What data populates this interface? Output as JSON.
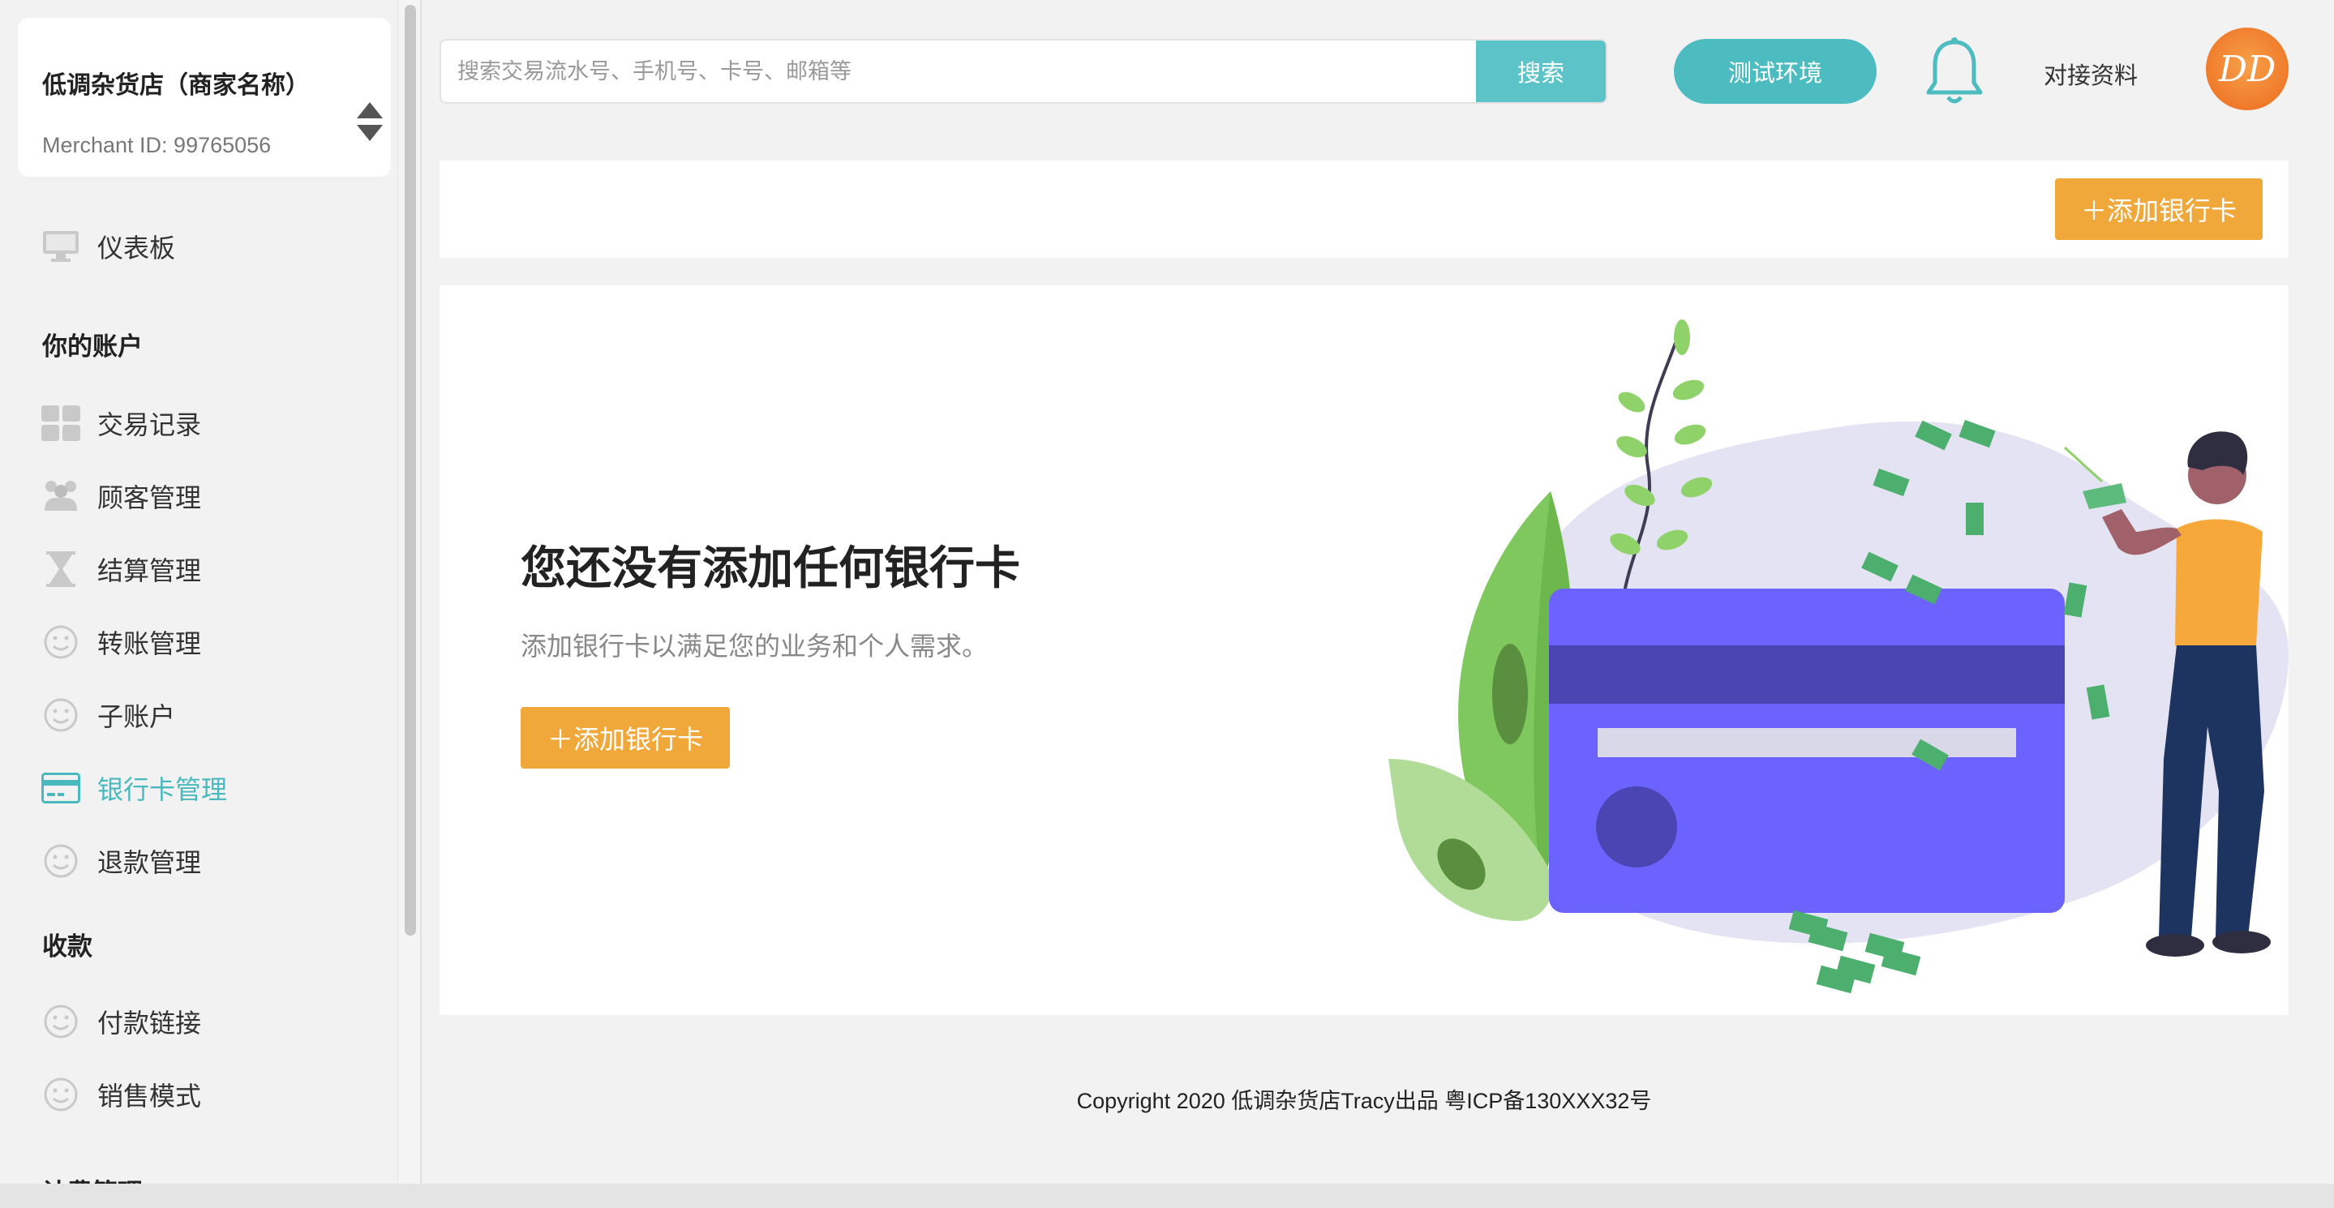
{
  "merchant": {
    "name": "低调杂货店（商家名称）",
    "id_label": "Merchant ID: 99765056"
  },
  "sidebar": {
    "items": [
      {
        "label": "仪表板",
        "icon": "monitor-icon"
      },
      {
        "label": "交易记录",
        "icon": "grid-icon"
      },
      {
        "label": "顾客管理",
        "icon": "users-icon"
      },
      {
        "label": "结算管理",
        "icon": "hourglass-icon"
      },
      {
        "label": "转账管理",
        "icon": "smile-icon"
      },
      {
        "label": "子账户",
        "icon": "smile-icon"
      },
      {
        "label": "银行卡管理",
        "icon": "credit-card-icon",
        "active": true
      },
      {
        "label": "退款管理",
        "icon": "smile-icon"
      },
      {
        "label": "付款链接",
        "icon": "smile-icon"
      },
      {
        "label": "销售模式",
        "icon": "smile-icon"
      }
    ],
    "sections": {
      "account": "你的账户",
      "payments": "收款",
      "billing": "计费管理"
    }
  },
  "header": {
    "search_placeholder": "搜索交易流水号、手机号、卡号、邮箱等",
    "search_button": "搜索",
    "env_button": "测试环境",
    "docs_link": "对接资料",
    "avatar_text": "DD"
  },
  "main": {
    "add_card_button": "＋添加银行卡",
    "empty_title": "您还没有添加任何银行卡",
    "empty_desc": "添加银行卡以满足您的业务和个人需求。",
    "empty_button": "＋添加银行卡"
  },
  "footer": {
    "text": "Copyright  2020 低调杂货店Tracy出品  粤ICP备130XXX32号"
  },
  "colors": {
    "accent": "#4dbcc0",
    "orange": "#f0a83b",
    "card_purple": "#6c63ff"
  }
}
